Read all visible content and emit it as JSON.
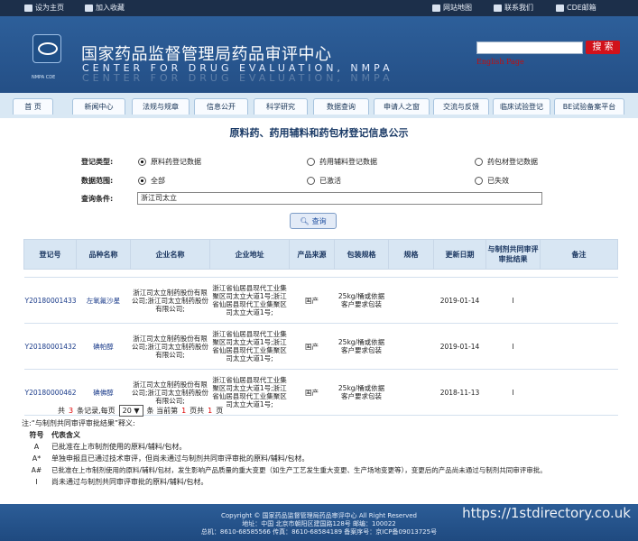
{
  "topbar": {
    "set_home": "设为主页",
    "bookmark": "加入收藏",
    "sitemap": "网站地图",
    "contact": "联系我们",
    "mail": "CDE邮箱"
  },
  "header": {
    "logo_caption": "NMPA CDE",
    "title_cn": "国家药品监督管理局药品审评中心",
    "title_en": "CENTER FOR DRUG EVALUATION, NMPA",
    "search_button": "搜 索",
    "english_page": "English Page"
  },
  "nav": [
    {
      "label": "首 页"
    },
    {
      "label": "新闻中心"
    },
    {
      "label": "法规与规章"
    },
    {
      "label": "信息公开"
    },
    {
      "label": "科学研究"
    },
    {
      "label": "数据查询"
    },
    {
      "label": "申请人之窗"
    },
    {
      "label": "交流与反馈"
    },
    {
      "label": "临床试验登记"
    },
    {
      "label": "BE试验备案平台"
    }
  ],
  "page_title": "原料药、药用辅料和药包材登记信息公示",
  "form": {
    "type_label": "登记类型:",
    "type_options": [
      "原料药登记数据",
      "药用辅料登记数据",
      "药包材登记数据"
    ],
    "scope_label": "数据范围:",
    "scope_options": [
      "全部",
      "已激活",
      "已失效"
    ],
    "query_label": "查询条件:",
    "query_value": "浙江司太立",
    "query_button": "查询"
  },
  "table": {
    "headers": [
      "登记号",
      "品种名称",
      "企业名称",
      "企业地址",
      "产品来源",
      "包装规格",
      "规格",
      "更新日期",
      "与制剂共同审评审批结果",
      "备注"
    ],
    "rows": [
      {
        "reg_no": "Y20180001433",
        "name": "左氧氟沙星",
        "company": "浙江司太立制药股份有限公司;浙江司太立制药股份有限公司;",
        "address": "浙江省仙居县现代工业集聚区司太立大道1号;浙江省仙居县现代工业集聚区司太立大道1号;",
        "source": "国产",
        "package": "25kg/桶或依据客户要求包装",
        "spec": "",
        "date": "2019-01-14",
        "result": "I",
        "remark": ""
      },
      {
        "reg_no": "Y20180001432",
        "name": "碘帕醇",
        "company": "浙江司太立制药股份有限公司;浙江司太立制药股份有限公司;",
        "address": "浙江省仙居县现代工业集聚区司太立大道1号;浙江省仙居县现代工业集聚区司太立大道1号;",
        "source": "国产",
        "package": "25kg/桶或依据客户要求包装",
        "spec": "",
        "date": "2019-01-14",
        "result": "I",
        "remark": ""
      },
      {
        "reg_no": "Y20180000462",
        "name": "碘佛醇",
        "company": "浙江司太立制药股份有限公司;浙江司太立制药股份有限公司;",
        "address": "浙江省仙居县现代工业集聚区司太立大道1号;浙江省仙居县现代工业集聚区司太立大道1号;",
        "source": "国产",
        "package": "25kg/桶或依据客户要求包装",
        "spec": "",
        "date": "2018-11-13",
        "result": "I",
        "remark": ""
      }
    ]
  },
  "pager": {
    "prefix": "共",
    "total": "3",
    "records_per_page": "条记录,每页",
    "page_size": "20",
    "mid": "条 当前第",
    "current": "1",
    "pages_text": "页共",
    "total_pages": "1",
    "suffix": "页"
  },
  "legend": {
    "note": "注:“与制剂共同审评审批结果”释义:",
    "header_code": "符号",
    "header_meaning": "代表含义",
    "items": [
      {
        "code": "A",
        "meaning": "已批准在上市制剂使用的原料/辅料/包材。"
      },
      {
        "code": "A*",
        "meaning": "单独申报且已通过技术审评，但尚未通过与制剂共同审评审批的原料/辅料/包材。"
      },
      {
        "code": "A#",
        "meaning": "已批准在上市制剂使用的原料/辅料/包材，发生影响产品质量的重大变更（如生产工艺发生重大变更、生产场地变更等），变更后的产品尚未通过与制剂共同审评审批。"
      },
      {
        "code": "I",
        "meaning": "尚未通过与制剂共同审评审批的原料/辅料/包材。"
      }
    ]
  },
  "footer": {
    "copyright": "Copyright © 国家药品监督管理局药品审评中心   All Right Reserved",
    "address": "地址：中国 北京市朝阳区建国路128号   邮编：100022",
    "phones": "总机：8610-68585566   传真：8610-68584189   备案序号：京ICP备09013725号"
  },
  "watermark": "https://1stdirectory.co.uk"
}
